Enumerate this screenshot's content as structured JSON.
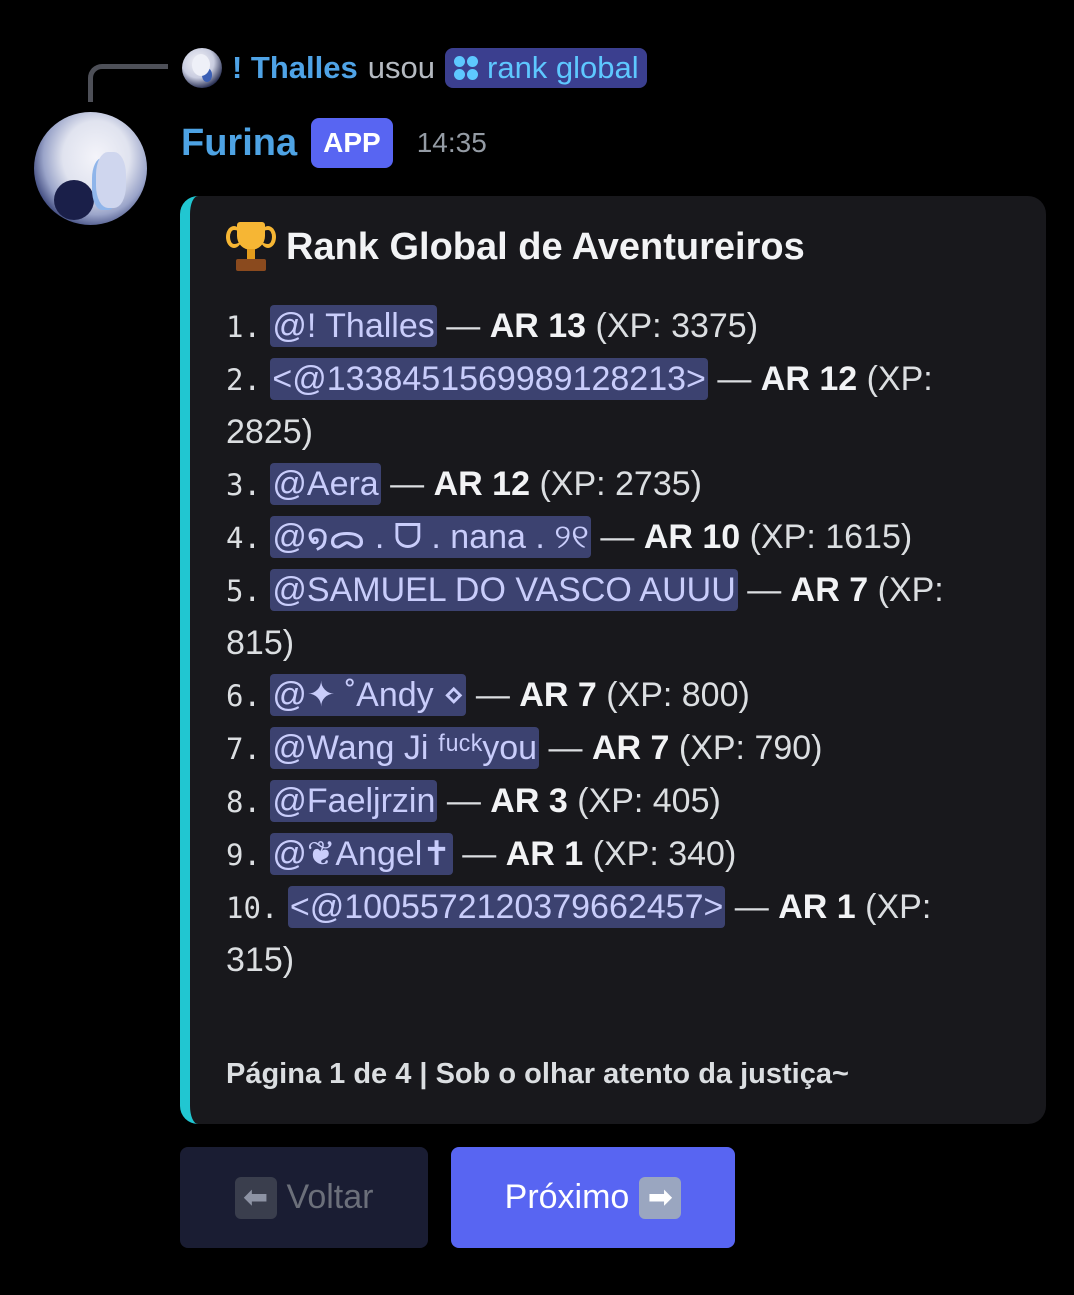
{
  "reply": {
    "user": "! Thalles",
    "verb": "usou",
    "command": "rank global"
  },
  "message": {
    "author": "Furina",
    "badge": "APP",
    "time": "14:35"
  },
  "embed": {
    "accent_color": "#21c6d1",
    "title": "Rank Global de Aventureiros",
    "title_icon": "trophy-icon",
    "entries": [
      {
        "num": "1.",
        "mention": "@! Thalles",
        "sep": " — ",
        "ar": "AR 13",
        "xp": " (XP: 3375)"
      },
      {
        "num": "2.",
        "mention": "<@1338451569989128213>",
        "sep": " — ",
        "ar": "AR 12",
        "xp": " (XP: 2825)"
      },
      {
        "num": "3.",
        "mention": "@Aera",
        "sep": " — ",
        "ar": "AR 12",
        "xp": " (XP: 2735)"
      },
      {
        "num": "4.",
        "mention": "@໑ᯅ . ᗜ . nana . ୨୧",
        "sep": " — ",
        "ar": "AR 10",
        "xp": " (XP: 1615)"
      },
      {
        "num": "5.",
        "mention": "@SAMUEL DO VASCO AUUU",
        "sep": " — ",
        "ar": "AR 7",
        "xp": " (XP: 815)"
      },
      {
        "num": "6.",
        "mention": "@✦ ˚Andy ⋄",
        "sep": " — ",
        "ar": "AR 7",
        "xp": " (XP: 800)"
      },
      {
        "num": "7.",
        "mention": "@Wang Ji ᶠᵘᶜᵏyou",
        "sep": " — ",
        "ar": "AR 7",
        "xp": " (XP: 790)"
      },
      {
        "num": "8.",
        "mention": "@Faeljrzin",
        "sep": " — ",
        "ar": "AR 3",
        "xp": " (XP: 405)"
      },
      {
        "num": "9.",
        "mention": "@❦Angel✝",
        "sep": " — ",
        "ar": "AR 1",
        "xp": " (XP: 340)"
      },
      {
        "num": "10.",
        "mention": "<@1005572120379662457>",
        "sep": " — ",
        "ar": "AR 1",
        "xp": " (XP: 315)"
      }
    ],
    "footer": "Página 1 de 4 | Sob o olhar atento da justiça~"
  },
  "buttons": {
    "back_label": "Voltar",
    "next_label": "Próximo"
  }
}
